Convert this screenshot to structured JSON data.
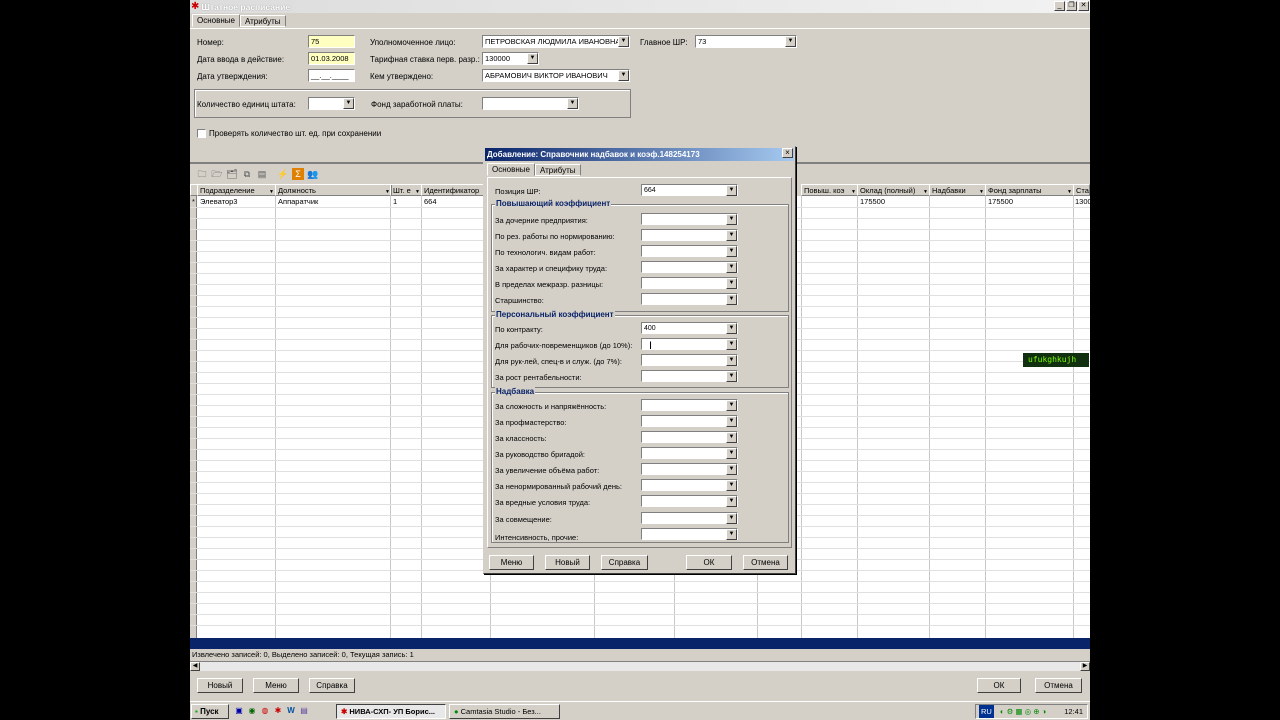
{
  "window": {
    "title": "Штатное расписание",
    "tabs": [
      "Основные",
      "Атрибуты"
    ]
  },
  "form": {
    "number_label": "Номер:",
    "number_value": "75",
    "effective_date_label": "Дата ввода в действие:",
    "effective_date_value": "01.03.2008",
    "approval_date_label": "Дата утверждения:",
    "approval_date_value": "__.__.____",
    "authorized_label": "Уполномоченное лицо:",
    "authorized_value": "ПЕТРОВСКАЯ ЛЮДМИЛА ИВАНОВНА",
    "tariff_label": "Тарифная ставка перв. разр.:",
    "tariff_value": "130000",
    "approved_by_label": "Кем утверждено:",
    "approved_by_value": "АБРАМОВИЧ ВИКТОР ИВАНОВИЧ",
    "main_label": "Главное ШР:",
    "main_value": "73",
    "units_label": "Количество единиц штата:",
    "units_value": "",
    "fund_label": "Фонд заработной платы:",
    "fund_value": "",
    "check_label": "Проверять количество шт. ед. при сохранении"
  },
  "grid": {
    "columns": [
      "Подразделение",
      "Должность",
      "Шт. е",
      "Идентификатор",
      "Повыш. коэ",
      "Оклад (полный)",
      "Надбавки",
      "Фонд зарплаты",
      "Ста"
    ],
    "row": {
      "indicator": "*",
      "department": "Элеватор3",
      "position": "Аппаратчик",
      "units": "1",
      "identifier": "664",
      "salary": "175500",
      "fund": "175500",
      "rate": "1300"
    }
  },
  "status_text": "Извлечено записей: 0, Выделено записей: 0, Текущая запись: 1",
  "bottom_buttons": {
    "new": "Новый",
    "menu": "Меню",
    "help": "Справка",
    "ok": "ОК",
    "cancel": "Отмена"
  },
  "dialog": {
    "title": "Добавление: Справочник надбавок и коэф.148254173",
    "close": "×",
    "tabs": [
      "Основные",
      "Атрибуты"
    ],
    "position_label": "Позиция ШР:",
    "position_value": "664",
    "section1": "Повышающий коэффициент",
    "s1_items": [
      {
        "label": "За дочерние предприятия:",
        "value": ""
      },
      {
        "label": "По рез. работы по нормированию:",
        "value": ""
      },
      {
        "label": "По технологич. видам работ:",
        "value": ""
      },
      {
        "label": "За характер и специфику труда:",
        "value": ""
      },
      {
        "label": "В пределах межразр. разницы:",
        "value": ""
      },
      {
        "label": "Старшинство:",
        "value": ""
      }
    ],
    "section2": "Персональный коэффициент",
    "s2_items": [
      {
        "label": "По контракту:",
        "value": "400"
      },
      {
        "label": "Для рабочих-повременщиков (до 10%):",
        "value": ""
      },
      {
        "label": "Для рук-лей, спец-в и служ. (до 7%):",
        "value": ""
      },
      {
        "label": "За рост рентабельности:",
        "value": ""
      }
    ],
    "section3": "Надбавка",
    "s3_items": [
      {
        "label": "За сложность и напряжённость:",
        "value": ""
      },
      {
        "label": "За профмастерство:",
        "value": ""
      },
      {
        "label": "За классность:",
        "value": ""
      },
      {
        "label": "За руководство бригадой:",
        "value": ""
      },
      {
        "label": "За увеличение объёма работ:",
        "value": ""
      },
      {
        "label": "За ненормированный рабочий день:",
        "value": ""
      },
      {
        "label": "За вредные условия труда:",
        "value": ""
      },
      {
        "label": "За совмещение:",
        "value": ""
      },
      {
        "label": "Интенсивность, прочие:",
        "value": ""
      }
    ],
    "buttons": {
      "menu": "Меню",
      "new": "Новый",
      "help": "Справка",
      "ok": "ОК",
      "cancel": "Отмена"
    }
  },
  "overlay_tag": "ufukghkujh",
  "taskbar": {
    "start": "Пуск",
    "tasks": [
      "НИВА-СХП- УП Борис...",
      "Camtasia Studio - Без..."
    ],
    "lang": "RU",
    "clock": "12:41"
  }
}
